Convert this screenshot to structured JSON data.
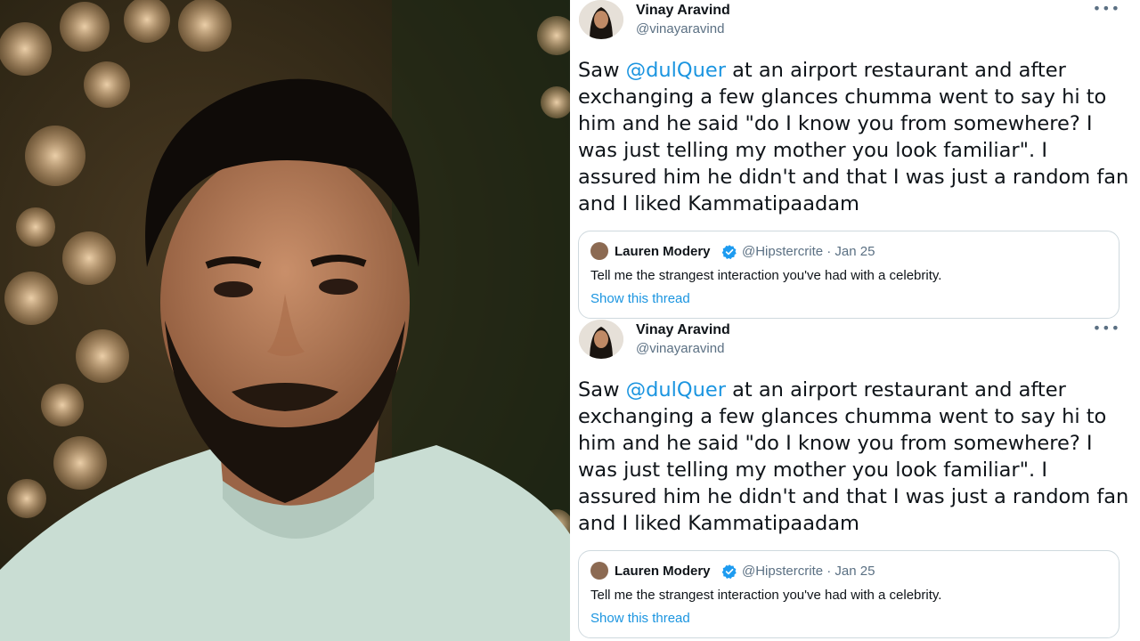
{
  "tweets": [
    {
      "author_name": "Vinay Aravind",
      "author_handle": "@vinayaravind",
      "more_label": "•••",
      "text_before": "Saw ",
      "mention": "@dulQuer",
      "text_after": " at an airport restaurant and after exchanging a few glances chumma went to say hi to him and he said \"do I know you from somewhere? I was just telling my mother you look familiar\". I assured him he didn't and that I was just a random fan and I liked Kammatipaadam",
      "quoted": {
        "author_name": "Lauren Modery",
        "meta": "@Hipstercrite · Jan 25",
        "text": "Tell me the strangest interaction you've had with a celebrity.",
        "link_label": "Show this thread"
      }
    },
    {
      "author_name": "Vinay Aravind",
      "author_handle": "@vinayaravind",
      "more_label": "•••",
      "text_before": "Saw ",
      "mention": "@dulQuer",
      "text_after": " at an airport restaurant and after exchanging a few glances chumma went to say hi to him and he said \"do I know you from somewhere? I was just telling my mother you look familiar\". I assured him he didn't and that I was just a random fan and I liked Kammatipaadam",
      "quoted": {
        "author_name": "Lauren Modery",
        "meta": "@Hipstercrite · Jan 25",
        "text": "Tell me the strangest interaction you've had with a celebrity.",
        "link_label": "Show this thread"
      }
    }
  ],
  "colors": {
    "link": "#1b95e0",
    "text": "#0f1419",
    "secondary": "#5b7083",
    "border": "#cfd9de",
    "verified": "#1d9bf0"
  },
  "icons": {
    "more": "more-horizontal-icon",
    "verified": "verified-badge-icon"
  }
}
